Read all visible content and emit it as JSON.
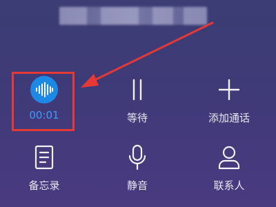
{
  "buttons": {
    "record": {
      "label": "00:01",
      "icon": "waveform-icon"
    },
    "hold": {
      "label": "等待",
      "icon": "pause-icon"
    },
    "add_call": {
      "label": "添加通话",
      "icon": "plus-icon"
    },
    "notes": {
      "label": "备忘录",
      "icon": "document-icon"
    },
    "mute": {
      "label": "静音",
      "icon": "microphone-icon"
    },
    "contacts": {
      "label": "联系人",
      "icon": "person-icon"
    }
  },
  "colors": {
    "record_accent": "#1e88e5",
    "record_text": "#3d9bff",
    "annotation": "#e53935",
    "label_text": "#e7e7f3"
  }
}
